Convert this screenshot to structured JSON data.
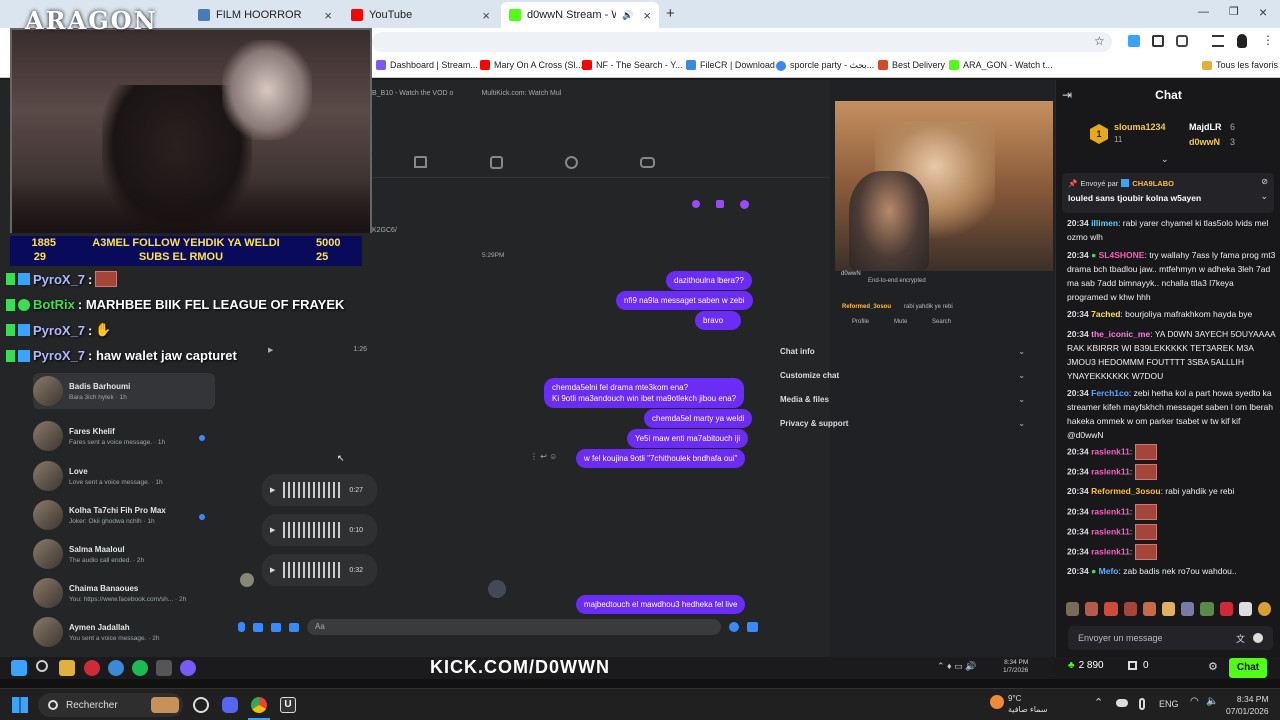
{
  "browser": {
    "tabs": [
      {
        "label": "FILM HOORROR"
      },
      {
        "label": "YouTube"
      },
      {
        "label": "d0wwN Stream - Watch Liv"
      }
    ],
    "bookmarks": [
      "Dashboard | Stream...",
      "Mary On A Cross (Sl...",
      "NF - The Search - Y...",
      "FileCR | Download",
      "sporcle party - بحث...",
      "Best Delivery",
      "ARA_GON - Watch t...",
      "Tous les favoris"
    ]
  },
  "overlay": {
    "logo": "ARAGON",
    "goal": {
      "row1_left": "1885",
      "row1_text": "A3MEL FOLLOW YEHDIK YA WELDI",
      "row1_right": "5000",
      "row2_left": "29",
      "row2_text": "SUBS EL RMOU",
      "row2_right": "25"
    },
    "chat_lines": [
      {
        "user": "PyroX_7",
        "text": ":"
      },
      {
        "user": "BotRix",
        "text": ": MARHBEE BIIK FEL LEAGUE OF FRAYEK"
      },
      {
        "user": "PyroX_7",
        "text": ":"
      },
      {
        "user": "PyroX_7",
        "text": ": haw walet jaw capturet"
      }
    ],
    "brand_url": "KICK.COM/D0WWN"
  },
  "messenger": {
    "inner_tabs": [
      "B_B10 - Watch the VOD o",
      "MultiKick.com: Watch Mul"
    ],
    "time_label": "5:29PM",
    "code_label": "K2GC6/",
    "conversations": [
      {
        "name": "Badis Barhoumi",
        "preview": "Bara 3ich hytek · 1h"
      },
      {
        "name": "Fares Khelif",
        "preview": "Fares sent a voice message. · 1h"
      },
      {
        "name": "Love",
        "preview": "Love sent a voice message. · 1h"
      },
      {
        "name": "Kolha Ta7chi Fih Pro Max",
        "preview": "Joker: Okii ghodwa nchlh · 1h"
      },
      {
        "name": "Salma Maaloul",
        "preview": "The audio call ended. · 2h"
      },
      {
        "name": "Chaima Banaoues",
        "preview": "You: https://www.facebook.com/sh... · 2h"
      },
      {
        "name": "Aymen Jadallah",
        "preview": "You sent a voice message. · 2h"
      }
    ],
    "bubbles": [
      "dazithoulna lbera??",
      "nfi9 na9la messaget saben w zebi",
      "bravo",
      "chemda5elni fel drama mte3kom ena?",
      "Ki 9otli ma3andouch win ibet ma9otlekch jibou ena?",
      "chemda5el marty ya weldi",
      "Ye5i maw enti ma7abitouch iji",
      "w fel koujina 9otli \"7chithoulek bndhafa oui\"",
      "majbedtouch el mawdhou3 hedheka fel live"
    ],
    "voice_messages": [
      "0:27",
      "0:10",
      "0:32"
    ],
    "top_voice_time": "1:26",
    "composer_placeholder": "Aa",
    "panel": [
      "Chat info",
      "Customize chat",
      "Media & files",
      "Privacy & support"
    ],
    "guest_lines": {
      "end_to_end": "End-to-end encrypted",
      "profile": "Profile",
      "mute": "Mute",
      "search": "Search",
      "rep_user": "Reformed_3osou",
      "rep_text": "rabi yahdik ye rebi",
      "cam_user": "d0wwN"
    }
  },
  "chat": {
    "title": "Chat",
    "leaderboard": [
      {
        "name": "slouma1234",
        "count": "11"
      },
      {
        "name": "MajdLR",
        "count": "6"
      },
      {
        "name": "d0wwN",
        "count": "3"
      }
    ],
    "pinned_by_label": "Envoyé par",
    "pinned_user": "CHA9LABO",
    "pinned_text": "louled sans tjoubir kolna w5ayen",
    "messages": [
      {
        "time": "20:34",
        "user": "illimen",
        "color": "#5ad0ff",
        "text": "rabi yarer chyamel ki tlas5olo lvids mel ozmo wlh"
      },
      {
        "time": "20:34",
        "user": "SL4SHONE",
        "color": "#ff5ac0",
        "text": "try wallahy 7ass ly fama prog mt3 drama bch tbadlou jaw.. mtfehmyn w adheka 3leh 7ad ma sab 7add bimnayyk.. nchalla ttla3 l7keya programed w khw hhh"
      },
      {
        "time": "20:34",
        "user": "7ached",
        "color": "#ffe14a",
        "text": "bourjoliya mafrakhkom hayda bye"
      },
      {
        "time": "20:34",
        "user": "the_iconic_me",
        "color": "#ff7ae6",
        "text": "YA D0WN 3AYECH 5OUYAAAA RAK KBIRRR WI B39LEKKKKK TET3AREK M3A JMOU3 HEDOMMM FOUTTTT 3SBA 5ALLLIH YNAYEKKKKKK W7DOU"
      },
      {
        "time": "20:34",
        "user": "Ferch1co",
        "color": "#5aaaff",
        "text": "zebi hetha kol a part howa syedto ka streamer kifeh mayfskhch messaget saben l om lberah hakeka ommek w om parker tsabet w tw kif kif @d0wwN"
      },
      {
        "time": "20:34",
        "user": "raslenk11",
        "color": "#ff5ac8",
        "text": ""
      },
      {
        "time": "20:34",
        "user": "raslenk11",
        "color": "#ff5ac8",
        "text": ""
      },
      {
        "time": "20:34",
        "user": "Reformed_3osou",
        "color": "#ffbf3a",
        "text": "rabi yahdik ye rebi"
      },
      {
        "time": "20:34",
        "user": "raslenk11",
        "color": "#ff5ac8",
        "text": ""
      },
      {
        "time": "20:34",
        "user": "raslenk11",
        "color": "#ff5ac8",
        "text": ""
      },
      {
        "time": "20:34",
        "user": "raslenk11",
        "color": "#ff5ac8",
        "text": ""
      },
      {
        "time": "20:34",
        "user": "Mefo",
        "color": "#5ab0ff",
        "text": "zab badis nek ro7ou wahdou.."
      }
    ],
    "input_placeholder": "Envoyer un message",
    "points": "2 890",
    "zero": "0",
    "send_label": "Chat"
  },
  "taskbar": {
    "search": "Rechercher",
    "weather_temp": "9°C",
    "weather_text": "سماء صافية",
    "lang": "ENG",
    "time": "8:34 PM",
    "date": "07/01/2026",
    "inner_time": "8:34 PM",
    "inner_date": "1/7/2026"
  },
  "colors": {
    "kick_green": "#53fc18",
    "messenger_purple": "#6b2cf5",
    "chat_bg": "#18181b"
  }
}
